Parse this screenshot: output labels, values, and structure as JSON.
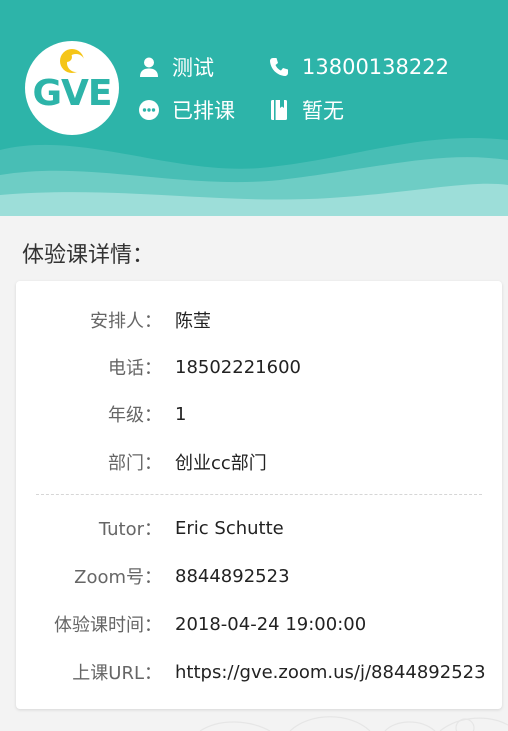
{
  "header": {
    "logo_text": "GVE",
    "name": "测试",
    "phone": "13800138222",
    "status": "已排课",
    "book": "暂无",
    "icons": {
      "name": "user-icon",
      "phone": "phone-icon",
      "status": "chat-bubble-icon",
      "book": "book-icon"
    },
    "colors": {
      "brand": "#2db4a9",
      "logo_accent": "#f5c518"
    }
  },
  "section": {
    "title": "体验课详情："
  },
  "details": {
    "arranger": {
      "label": "安排人：",
      "value": "陈莹"
    },
    "phone": {
      "label": "电话：",
      "value": "18502221600"
    },
    "grade": {
      "label": "年级：",
      "value": "1"
    },
    "department": {
      "label": "部门：",
      "value": "创业cc部门"
    },
    "tutor": {
      "label": "Tutor：",
      "value": "Eric Schutte"
    },
    "zoom": {
      "label": "Zoom号：",
      "value": "8844892523"
    },
    "time": {
      "label": "体验课时间：",
      "value": "2018-04-24 19:00:00"
    },
    "url": {
      "label": "上课URL：",
      "value": "https://gve.zoom.us/j/8844892523"
    }
  }
}
